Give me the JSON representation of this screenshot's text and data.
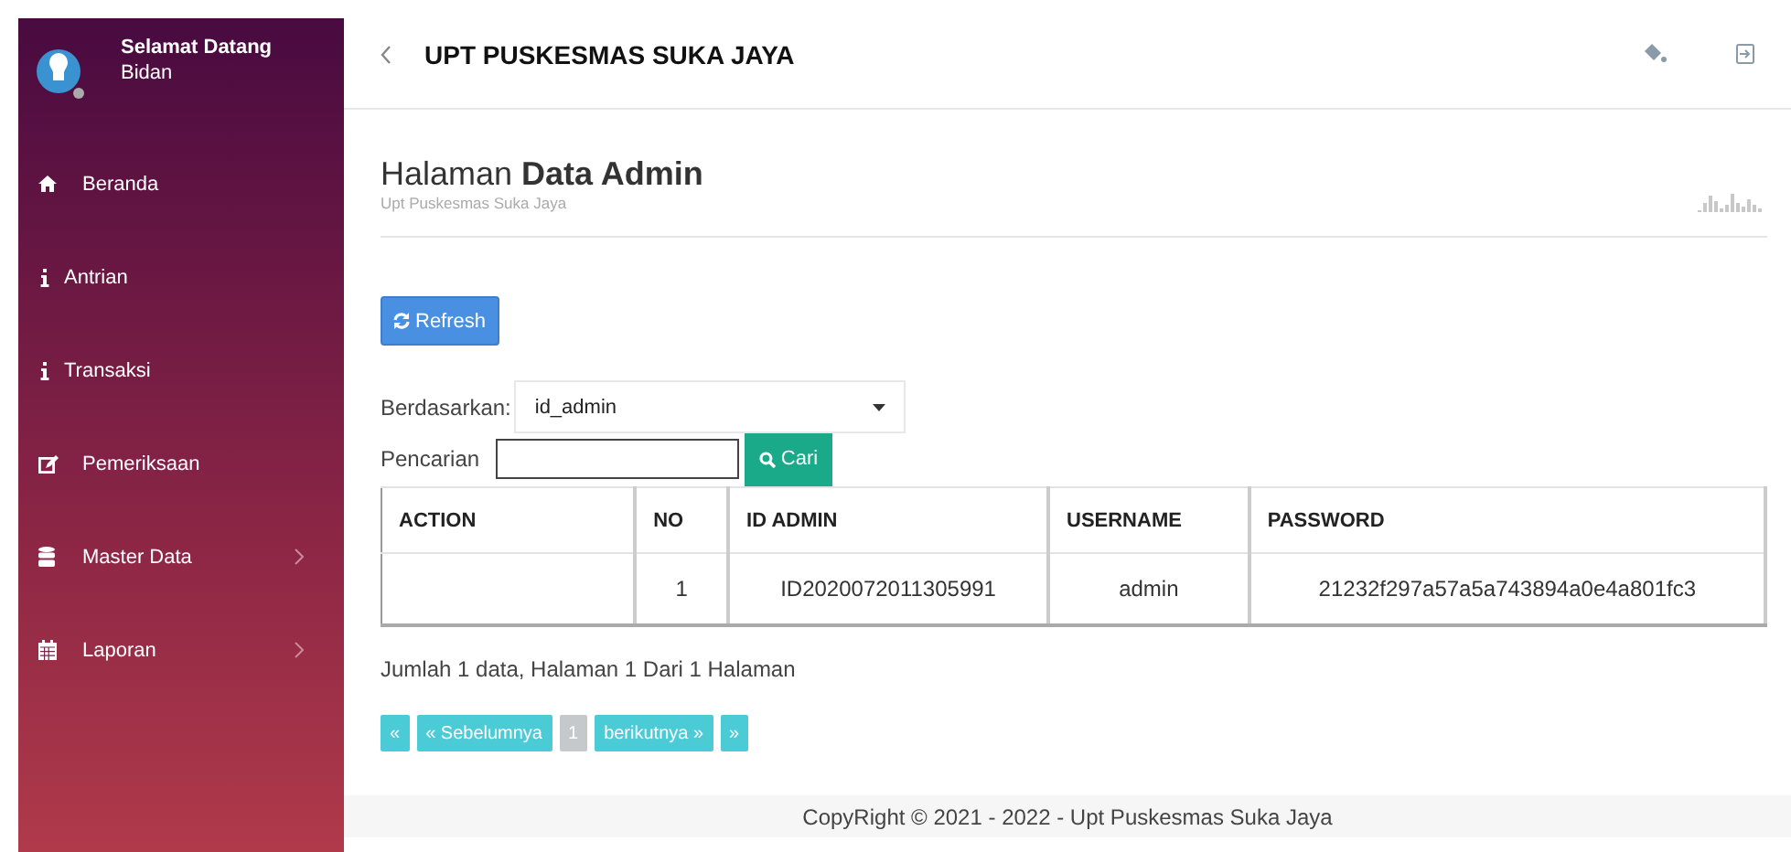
{
  "sidebar": {
    "greeting": "Selamat Datang",
    "role": "Bidan",
    "items": [
      {
        "label": "Beranda",
        "kind": "home",
        "has_submenu": false
      },
      {
        "label": "Antrian",
        "kind": "info",
        "has_submenu": false
      },
      {
        "label": "Transaksi",
        "kind": "info",
        "has_submenu": false
      },
      {
        "label": "Pemeriksaan",
        "kind": "edit",
        "has_submenu": false
      },
      {
        "label": "Master Data",
        "kind": "database",
        "has_submenu": true
      },
      {
        "label": "Laporan",
        "kind": "calendar",
        "has_submenu": true
      }
    ]
  },
  "topbar": {
    "title": "UPT PUSKESMAS SUKA JAYA"
  },
  "page": {
    "title": "Halaman **Data Admin**",
    "subtitle": "Upt Puskesmas Suka Jaya"
  },
  "refresh_button": "Refresh",
  "filter": {
    "label": "Berdasarkan:",
    "value": "id_admin"
  },
  "search": {
    "label": "Pencarian",
    "button": "Cari"
  },
  "table": {
    "columns": [
      "ACTION",
      "NO",
      "ID ADMIN",
      "USERNAME",
      "PASSWORD"
    ],
    "rows": [
      {
        "no": "1",
        "id_admin": "ID2020072011305991",
        "username": "admin",
        "password": "21232f297a57a5a743894a0e4a801fc3"
      }
    ]
  },
  "summary": "Jumlah 1 data, Halaman 1 Dari 1 Halaman",
  "pagination": [
    {
      "label": "«",
      "selected": false
    },
    {
      "label": "« Sebelumnya",
      "selected": false
    },
    {
      "label": "1",
      "selected": true
    },
    {
      "label": "berikutnya »",
      "selected": false
    },
    {
      "label": "»",
      "selected": false
    }
  ],
  "footer": "CopyRight © 2021 - 2022 - Upt Puskesmas Suka Jaya"
}
